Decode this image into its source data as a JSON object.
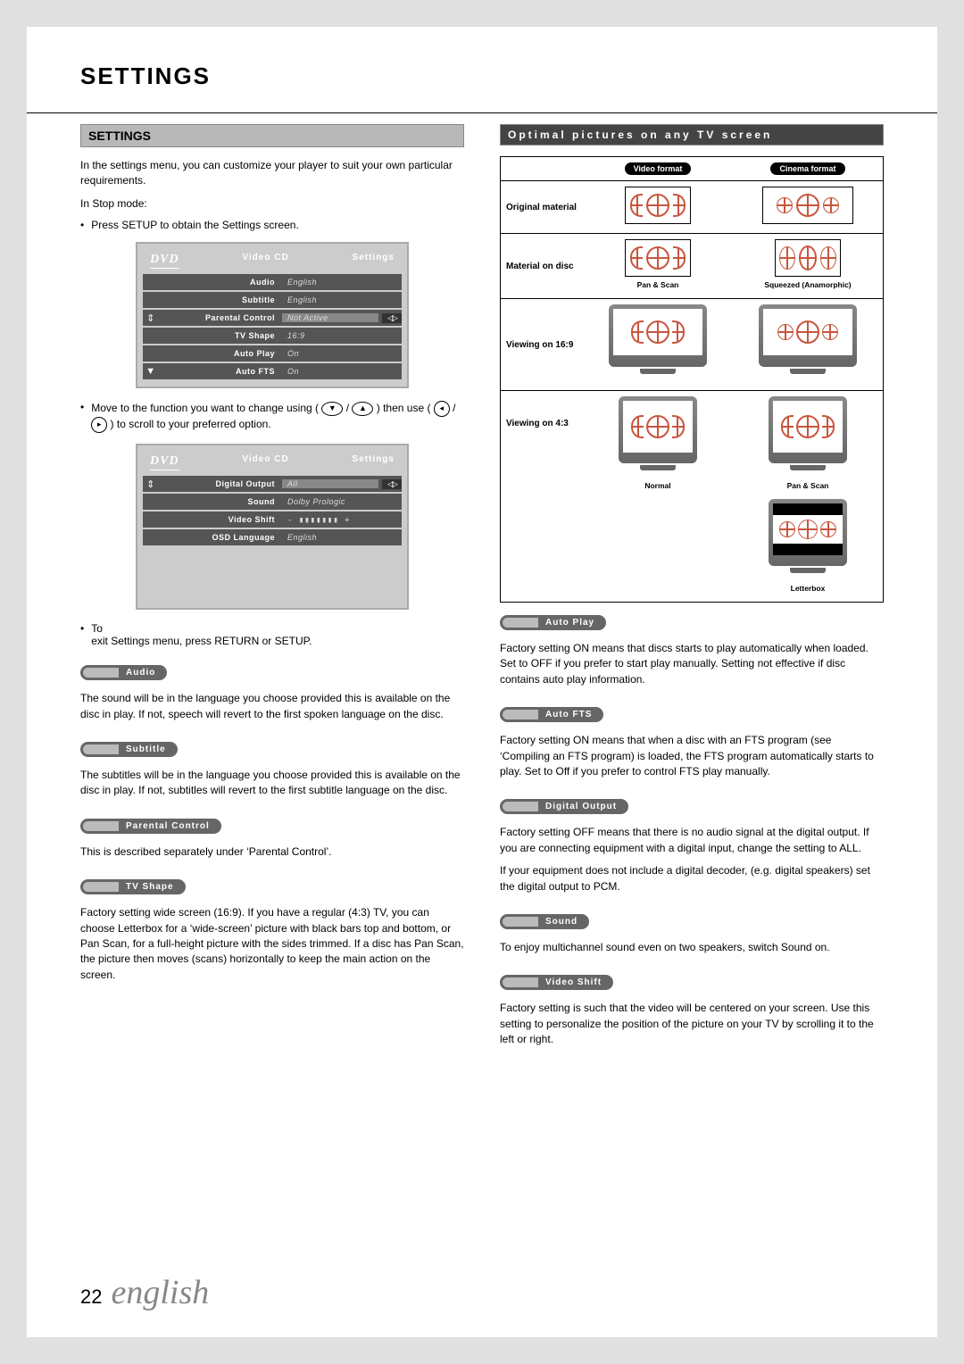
{
  "title": "SETTINGS",
  "settings_header": "SETTINGS",
  "intro": "In the settings menu, you can customize your player to suit your own particular requirements.",
  "stop_mode": "In Stop mode:",
  "press_setup": "Press SETUP to obtain the Settings screen.",
  "osd1": {
    "dvd": "DVD",
    "left": "Video CD",
    "right": "Settings",
    "rows": [
      {
        "label": "Audio",
        "value": "English"
      },
      {
        "label": "Subtitle",
        "value": "English"
      },
      {
        "label": "Parental Control",
        "value": "Not Active",
        "selected": true,
        "icon": "updown"
      },
      {
        "label": "TV Shape",
        "value": "16:9"
      },
      {
        "label": "Auto Play",
        "value": "On"
      },
      {
        "label": "Auto FTS",
        "value": "On",
        "icon": "down"
      }
    ]
  },
  "move_text_a": "Move to the function you want to change using (",
  "move_text_b": " /",
  "move_text_c": " ) then use (",
  "move_text_d": " /",
  "move_text_e": " ) to scroll to your preferred option.",
  "osd2": {
    "dvd": "DVD",
    "left": "Video CD",
    "right": "Settings",
    "rows": [
      {
        "label": "Digital Output",
        "value": "All",
        "selected": true,
        "icon": "updown"
      },
      {
        "label": "Sound",
        "value": "Dolby Prologic"
      },
      {
        "label": "Video Shift",
        "value": "slider"
      },
      {
        "label": "OSD Language",
        "value": "English"
      }
    ]
  },
  "exit_a": "To",
  "exit_b": "exit Settings menu, press RETURN or SETUP.",
  "sections_left": [
    {
      "heading": "Audio",
      "body": "The sound will be in the language you choose provided this is available on the disc in play. If not, speech will revert to the first spoken language on the disc."
    },
    {
      "heading": "Subtitle",
      "body": "The subtitles will be in the language you choose provided this is available on the disc in play. If not, subtitles will revert to the first subtitle language on the disc."
    },
    {
      "heading": "Parental Control",
      "body": "This is described separately under ‘Parental Control’."
    },
    {
      "heading": "TV Shape",
      "body": "Factory setting wide screen (16:9). If you have a regular (4:3) TV, you can choose Letterbox for a ‘wide-screen’ picture with black bars top and bottom, or Pan Scan, for a full-height picture with the sides trimmed. If a disc has Pan Scan, the picture then moves (scans) horizontally to keep the main action on the screen."
    }
  ],
  "optimal_header": "Optimal pictures on any TV screen",
  "tvgrid": {
    "col1": "Video format",
    "col2": "Cinema format",
    "rows": [
      {
        "label": "Original material"
      },
      {
        "label": "Material on disc",
        "cap1": "Pan & Scan",
        "cap2": "Squeezed (Anamorphic)"
      },
      {
        "label": "Viewing on 16:9"
      },
      {
        "label": "Viewing on 4:3",
        "cap1": "Normal",
        "cap2": "Pan & Scan",
        "cap3": "Letterbox"
      }
    ]
  },
  "sections_right": [
    {
      "heading": "Auto Play",
      "body": "Factory setting ON means that discs starts to play automatically when loaded. Set to OFF if you prefer to start play manually. Setting not effective if disc contains auto play information."
    },
    {
      "heading": "Auto FTS",
      "body": "Factory setting ON means that when a disc with an FTS program (see ‘Compiling an FTS program) is loaded, the FTS program automatically starts to play. Set to Off if you prefer to control FTS play manually."
    },
    {
      "heading": "Digital Output",
      "body": "Factory setting OFF means that there is no audio signal at the digital output. If you are connecting equipment with a digital input, change the setting to ALL.",
      "body2": "If your equipment does not include a digital decoder, (e.g. digital speakers) set the digital output to PCM."
    },
    {
      "heading": "Sound",
      "body": "To enjoy multichannel sound even on two speakers, switch Sound on."
    },
    {
      "heading": "Video Shift",
      "body": "Factory setting is such that the video will be centered on your screen. Use this setting to personalize the position of the picture on your TV by scrolling it to the left or right."
    }
  ],
  "footer": {
    "page": "22",
    "lang": "english"
  },
  "slider": "- ▮▮▮▮▮▮▮ +"
}
